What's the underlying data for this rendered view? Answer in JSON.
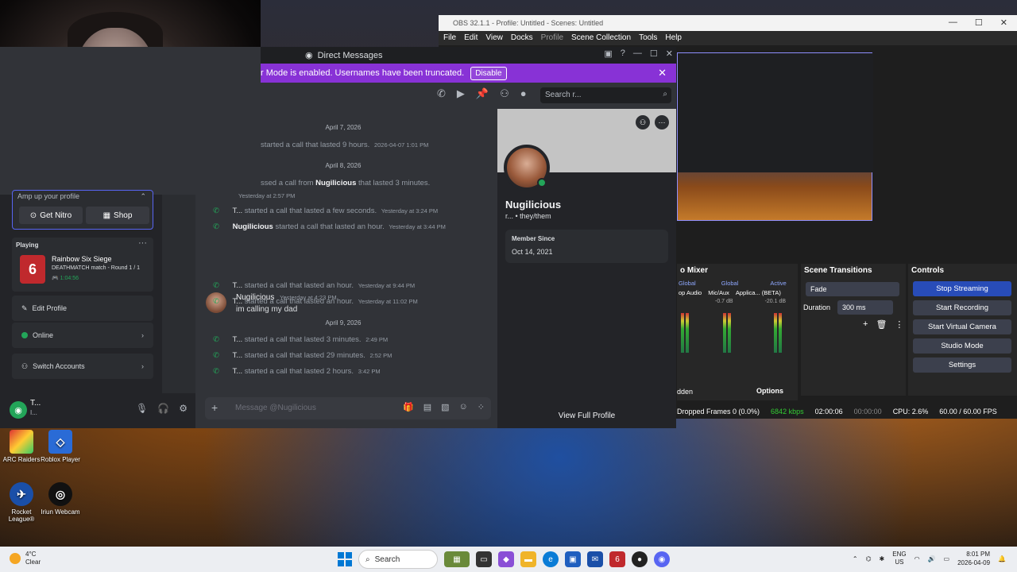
{
  "discord": {
    "window_title": "Direct Messages",
    "banner_text": "r Mode is enabled. Usernames have been truncated.",
    "banner_button": "Disable",
    "search_placeholder": "Search r...",
    "amp_label": "Amp up your profile",
    "get_nitro": "Get Nitro",
    "shop": "Shop",
    "playing_header": "Playing",
    "game_name": "Rainbow Six Siege",
    "game_state": "DEATHMATCH match - Round 1 / 1",
    "game_time": "1:04:56",
    "edit_profile": "Edit Profile",
    "online": "Online",
    "switch_accounts": "Switch Accounts",
    "user_name": "T...",
    "user_status": "I...",
    "messages": [
      {
        "type": "date",
        "text": "April 7, 2026"
      },
      {
        "type": "call",
        "who": "",
        "text": "started a call that lasted 9 hours.",
        "ts": "2026-04-07 1:01 PM"
      },
      {
        "type": "date",
        "text": "April 8, 2026"
      },
      {
        "type": "missed",
        "text": "ssed a call from",
        "from": "Nugilicious",
        "tail": "that lasted 3 minutes.",
        "ts": "Yesterday at 2:57 PM"
      },
      {
        "type": "call",
        "who": "T...",
        "text": "started a call that lasted a few seconds.",
        "ts": "Yesterday at 3:24 PM"
      },
      {
        "type": "call",
        "who": "Nugilicious",
        "text": "started a call that lasted an hour.",
        "ts": "Yesterday at 3:44 PM"
      },
      {
        "type": "call",
        "who": "T...",
        "text": "started a call that lasted an hour.",
        "ts": "Yesterday at 9:44 PM"
      },
      {
        "type": "call",
        "who": "T...",
        "text": "started a call that lasted an hour.",
        "ts": "Yesterday at 11:02 PM"
      },
      {
        "type": "date",
        "text": "April 9, 2026"
      },
      {
        "type": "call",
        "who": "T...",
        "text": "started a call that lasted 3 minutes.",
        "ts": "2:49 PM"
      },
      {
        "type": "call",
        "who": "T...",
        "text": "started a call that lasted 29 minutes.",
        "ts": "2:52 PM"
      },
      {
        "type": "call",
        "who": "T...",
        "text": "started a call that lasted 2 hours.",
        "ts": "3:42 PM"
      }
    ],
    "message_author": "Nugilicious",
    "message_ts": "Yesterday at 4:23 PM",
    "message_body": "im calling my dad",
    "composer_placeholder": "Message @Nugilicious",
    "profile": {
      "name": "Nugilicious",
      "sub": "r... • they/them",
      "member_since_label": "Member Since",
      "member_since": "Oct 14, 2021",
      "view_full": "View Full Profile"
    }
  },
  "obs": {
    "title": "OBS 32.1.1 - Profile: Untitled - Scenes: Untitled",
    "menu": [
      "File",
      "Edit",
      "View",
      "Docks",
      "Profile",
      "Scene Collection",
      "Tools",
      "Help"
    ],
    "mixer_title": "o Mixer",
    "mixer_labels": [
      "Global",
      "Global",
      "Active"
    ],
    "mixer_sources": [
      "op Audio",
      "Mic/Aux",
      "Applica... (BETA)"
    ],
    "mixer_db": [
      "-0.7 dB",
      "-20.1 dB"
    ],
    "transitions_title": "Scene Transitions",
    "transition": "Fade",
    "duration_label": "Duration",
    "duration": "300 ms",
    "controls_title": "Controls",
    "buttons": [
      "Stop Streaming",
      "Start Recording",
      "Start Virtual Camera",
      "Studio Mode",
      "Settings"
    ],
    "sources_hidden": "dden",
    "options": "Options",
    "status": {
      "dropped": "Dropped Frames 0 (0.0%)",
      "kbps": "6842 kbps",
      "stream_time": "02:00:06",
      "rec_time": "00:00:00",
      "cpu": "CPU: 2.6%",
      "fps": "60.00 / 60.00 FPS"
    }
  },
  "desktop": {
    "icons": [
      "ARC Raiders",
      "Roblox Player",
      "Rocket League®",
      "Iriun Webcam"
    ]
  },
  "taskbar": {
    "temp": "4°C",
    "weather": "Clear",
    "search": "Search",
    "lang1": "ENG",
    "lang2": "US",
    "time": "8:01 PM",
    "date": "2026-04-09"
  }
}
